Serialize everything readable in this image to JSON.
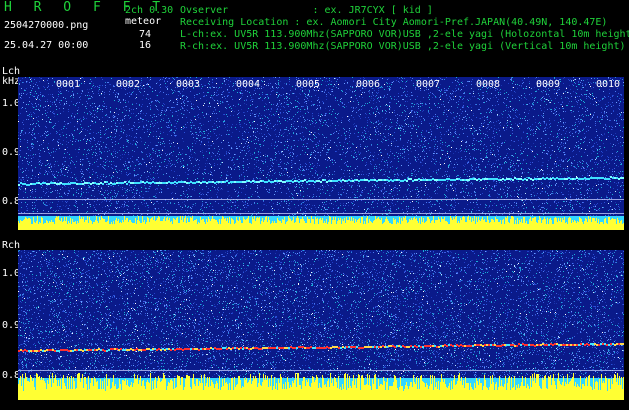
{
  "header": {
    "brand": "H R O F F T",
    "mode": "2ch 0.30",
    "kind": "meteor",
    "filename": "2504270000.png",
    "timestamp": "25.04.27 00:00",
    "count_l": "74",
    "count_r": "16",
    "observer_line": "Ovserver              : ex. JR7CYX [ kid ]",
    "location_line": "Receiving Location : ex. Aomori City Aomori-Pref.JAPAN(40.49N, 140.47E)",
    "lch_line": "L-ch:ex. UV5R 113.900Mhz(SAPPORO VOR)USB ,2-ele yagi (Holozontal 10m height",
    "rch_line": "R-ch:ex. UV5R 113.900Mhz(SAPPORO VOR)USB ,2-ele yagi (Vertical 10m height)"
  },
  "lch": {
    "label": "Lch",
    "unit": "kHz",
    "yticks": [
      "1.0",
      "0.9",
      "0.8"
    ]
  },
  "rch": {
    "label": "Rch",
    "yticks": [
      "1.0",
      "0.9",
      "0.8"
    ]
  },
  "minutes": [
    "0001",
    "0002",
    "0003",
    "0004",
    "0005",
    "0006",
    "0007",
    "0008",
    "0009",
    "0010"
  ],
  "colors": {
    "background": "#000000",
    "noise": "#1f3fbf",
    "header_green": "#1fd23a",
    "yellow": "#ffff33",
    "cyan": "#33e6ff",
    "signal_red": "#ff3030"
  }
}
